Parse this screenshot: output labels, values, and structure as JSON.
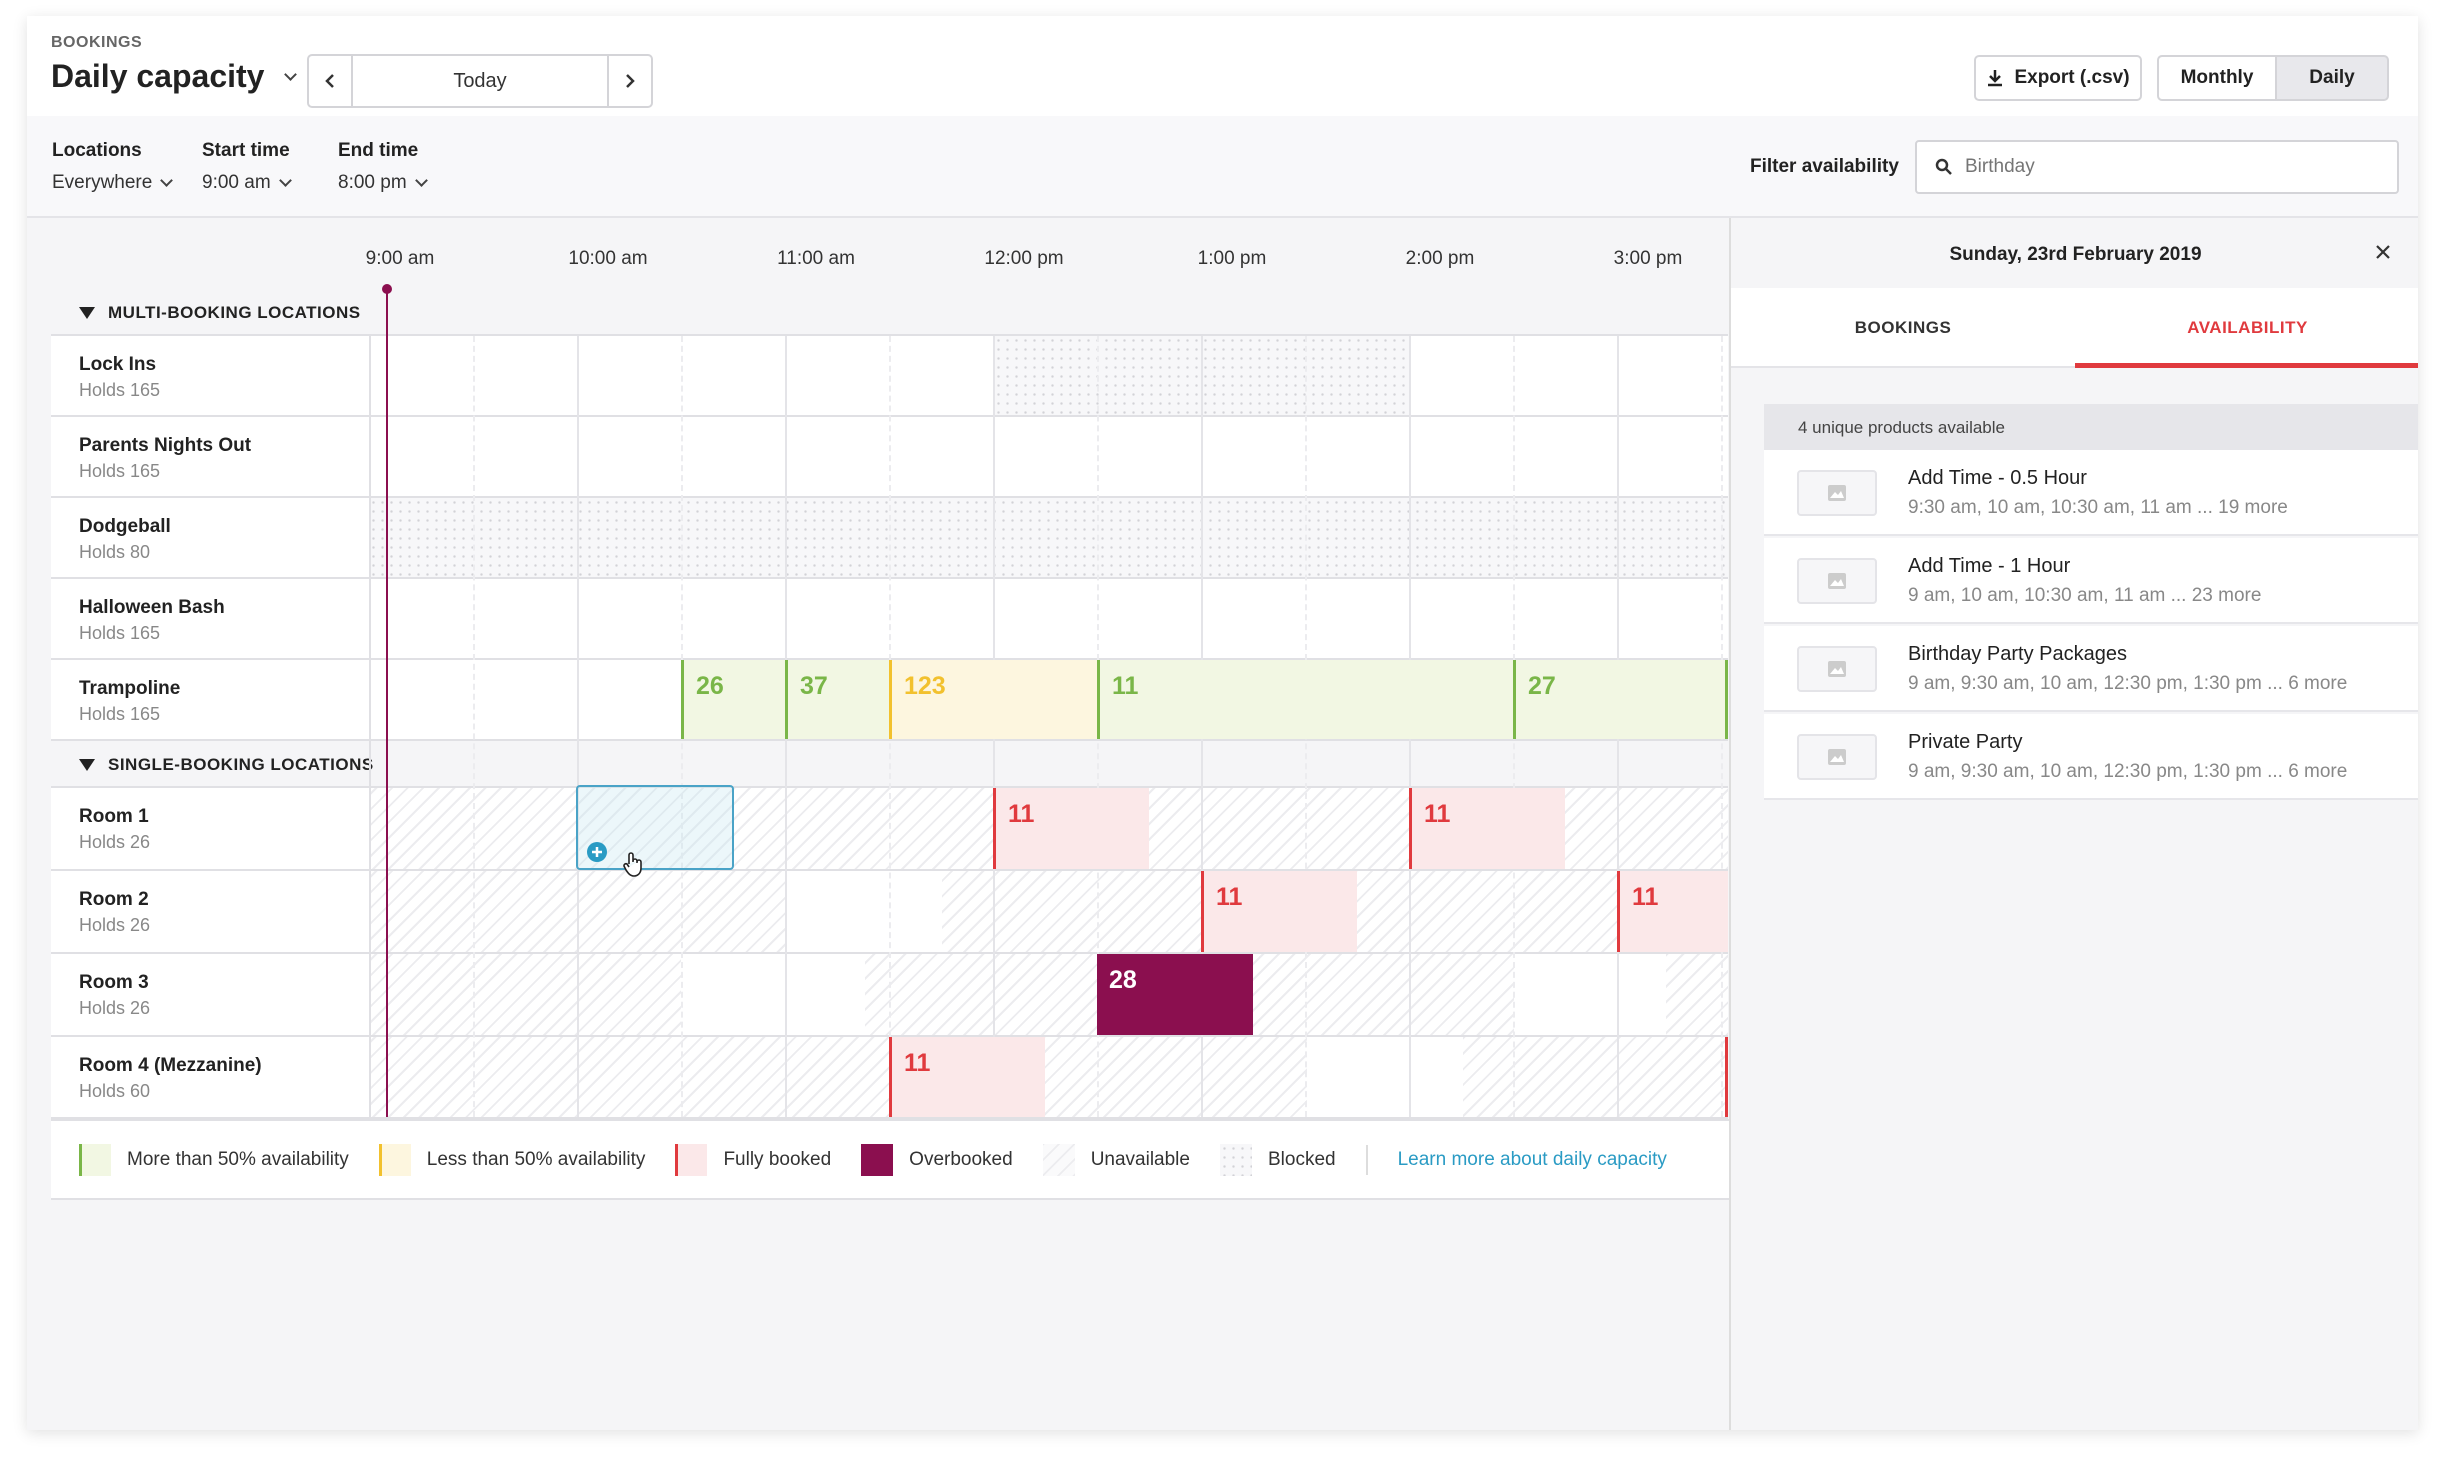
{
  "header": {
    "section_label": "BOOKINGS",
    "title": "Daily capacity",
    "date_nav_label": "Today",
    "export_label": "Export (.csv)",
    "view_monthly": "Monthly",
    "view_daily": "Daily",
    "active_view": "Daily"
  },
  "filters": {
    "locations_label": "Locations",
    "locations_value": "Everywhere",
    "start_label": "Start time",
    "start_value": "9:00 am",
    "end_label": "End time",
    "end_value": "8:00 pm",
    "availability_label": "Filter availability",
    "search_placeholder": "Birthday"
  },
  "timeline": {
    "ticks": [
      "9:00 am",
      "10:00 am",
      "11:00 am",
      "12:00 pm",
      "1:00 pm",
      "2:00 pm",
      "3:00 pm"
    ]
  },
  "sections": [
    {
      "title": "MULTI-BOOKING LOCATIONS",
      "rows": [
        {
          "name": "Lock Ins",
          "holds": "Holds 165"
        },
        {
          "name": "Parents Nights Out",
          "holds": "Holds 165"
        },
        {
          "name": "Dodgeball",
          "holds": "Holds 80"
        },
        {
          "name": "Halloween Bash",
          "holds": "Holds 165"
        },
        {
          "name": "Trampoline",
          "holds": "Holds 165"
        }
      ]
    },
    {
      "title": "SINGLE-BOOKING LOCATIONS",
      "rows": [
        {
          "name": "Room 1",
          "holds": "Holds 26"
        },
        {
          "name": "Room 2",
          "holds": "Holds 26"
        },
        {
          "name": "Room 3",
          "holds": "Holds 26"
        },
        {
          "name": "Room 4 (Mezzanine)",
          "holds": "Holds 60"
        }
      ]
    }
  ],
  "cells": {
    "trampoline": [
      "26",
      "37",
      "123",
      "11",
      "27"
    ],
    "room1": [
      "11",
      "11"
    ],
    "room2": [
      "11",
      "11"
    ],
    "room3": [
      "28"
    ],
    "room4": [
      "11"
    ]
  },
  "legend": {
    "more_than_half": "More than 50% availability",
    "less_than_half": "Less than 50% availability",
    "fully_booked": "Fully booked",
    "overbooked": "Overbooked",
    "unavailable": "Unavailable",
    "blocked": "Blocked",
    "learn_more": "Learn more about daily capacity"
  },
  "colors": {
    "accent_red": "#e03a3e",
    "green": "#7ab648",
    "yellow": "#f2c12e",
    "overbooked": "#8b0f4f",
    "link": "#2a9bc4"
  },
  "panel": {
    "date": "Sunday, 23rd February 2019",
    "tab_bookings": "BOOKINGS",
    "tab_availability": "AVAILABILITY",
    "active_tab": "AVAILABILITY",
    "count_label": "4 unique products available",
    "products": [
      {
        "name": "Add Time - 0.5 Hour",
        "times": "9:30 am, 10 am, 10:30 am, 11 am ... 19 more"
      },
      {
        "name": "Add Time - 1 Hour",
        "times": "9 am, 10 am, 10:30 am, 11 am ... 23 more"
      },
      {
        "name": "Birthday Party Packages",
        "times": "9 am, 9:30 am, 10 am, 12:30 pm, 1:30 pm ... 6 more"
      },
      {
        "name": "Private Party",
        "times": "9 am, 9:30 am, 10 am, 12:30 pm, 1:30 pm ... 6 more"
      }
    ]
  }
}
